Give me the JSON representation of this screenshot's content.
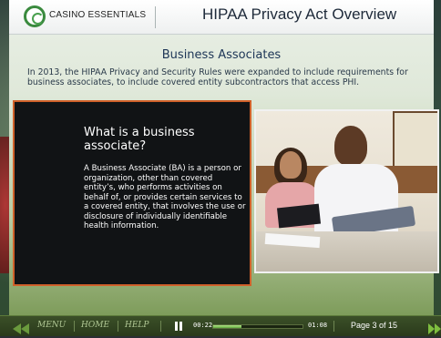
{
  "header": {
    "brand": "CASINO ESSENTIALS",
    "title": "HIPAA Privacy Act Overview"
  },
  "main": {
    "section_title": "Business Associates",
    "intro": "In 2013, the HIPAA Privacy and Security Rules were expanded to include requirements for business associates, to include covered entity subcontractors that access PHI.",
    "card": {
      "question": "What is a business associate?",
      "answer": "A Business Associate (BA) is a person or organization, other than covered entity’s, who performs activities on behalf of, or provides certain services to a covered entity, that involves the use or disclosure of individually identifiable health information."
    }
  },
  "footer": {
    "menu_label": "MENU",
    "home_label": "HOME",
    "help_label": "HELP",
    "elapsed": "00:22",
    "duration": "01:08",
    "progress_fraction": 0.32,
    "page_indicator": "Page 3 of 15"
  },
  "icons": {
    "prev": "double-left-arrow-icon",
    "next": "double-right-arrow-icon",
    "pause": "pause-icon",
    "logo": "casino-essentials-logo"
  },
  "colors": {
    "card_border": "#d0612a",
    "footer_text": "#b0c794",
    "progress": "#7cc14f"
  }
}
